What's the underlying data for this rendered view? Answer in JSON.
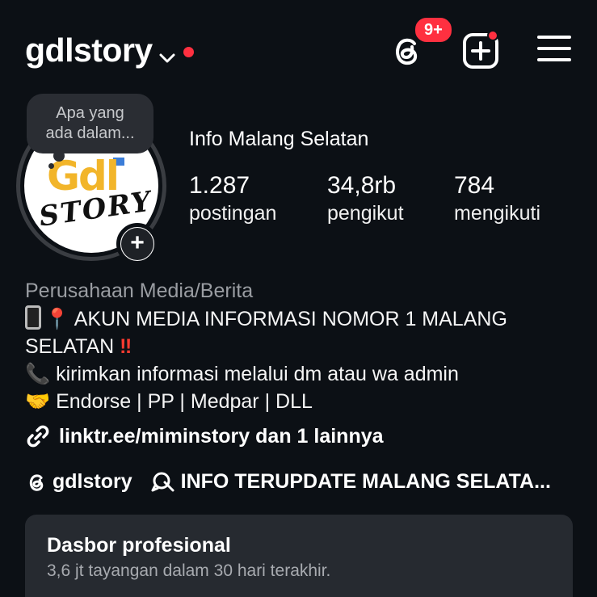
{
  "header": {
    "username": "gdlstory",
    "threads_badge": "9+",
    "icons": [
      "chevron-down-icon",
      "threads-icon",
      "create-icon",
      "menu-icon"
    ]
  },
  "note": {
    "text_line1": "Apa yang",
    "text_line2": "ada dalam..."
  },
  "profile": {
    "display_name": "Info Malang Selatan",
    "logo_text_top": "Gdl",
    "logo_text_bottom": "STORY",
    "stats": [
      {
        "value": "1.287",
        "label": "postingan"
      },
      {
        "value": "34,8rb",
        "label": "pengikut"
      },
      {
        "value": "784",
        "label": "mengikuti"
      }
    ]
  },
  "bio": {
    "category": "Perusahaan Media/Berita",
    "line1_text": " AKUN MEDIA INFORMASI NOMOR 1 MALANG",
    "line2_text": "SELATAN ",
    "line3_text": " kirimkan informasi melalui dm atau wa admin",
    "line4_text": " Endorse | PP | Medpar | DLL",
    "pin_emoji": "📍",
    "bang_emoji": "‼",
    "receiver_emoji": "📞",
    "hands_emoji": "🤝"
  },
  "link": {
    "text": "linktr.ee/miminstory dan 1 lainnya"
  },
  "tags": {
    "threads_handle": "gdlstory",
    "channel": "INFO TERUPDATE MALANG SELATA..."
  },
  "dashboard": {
    "title": "Dasbor profesional",
    "subtitle": "3,6 jt tayangan dalam 30 hari terakhir."
  },
  "colors": {
    "background": "#0c1015",
    "notification_red": "#ff3040",
    "card": "#262a30",
    "muted_text": "#9a9da2"
  }
}
